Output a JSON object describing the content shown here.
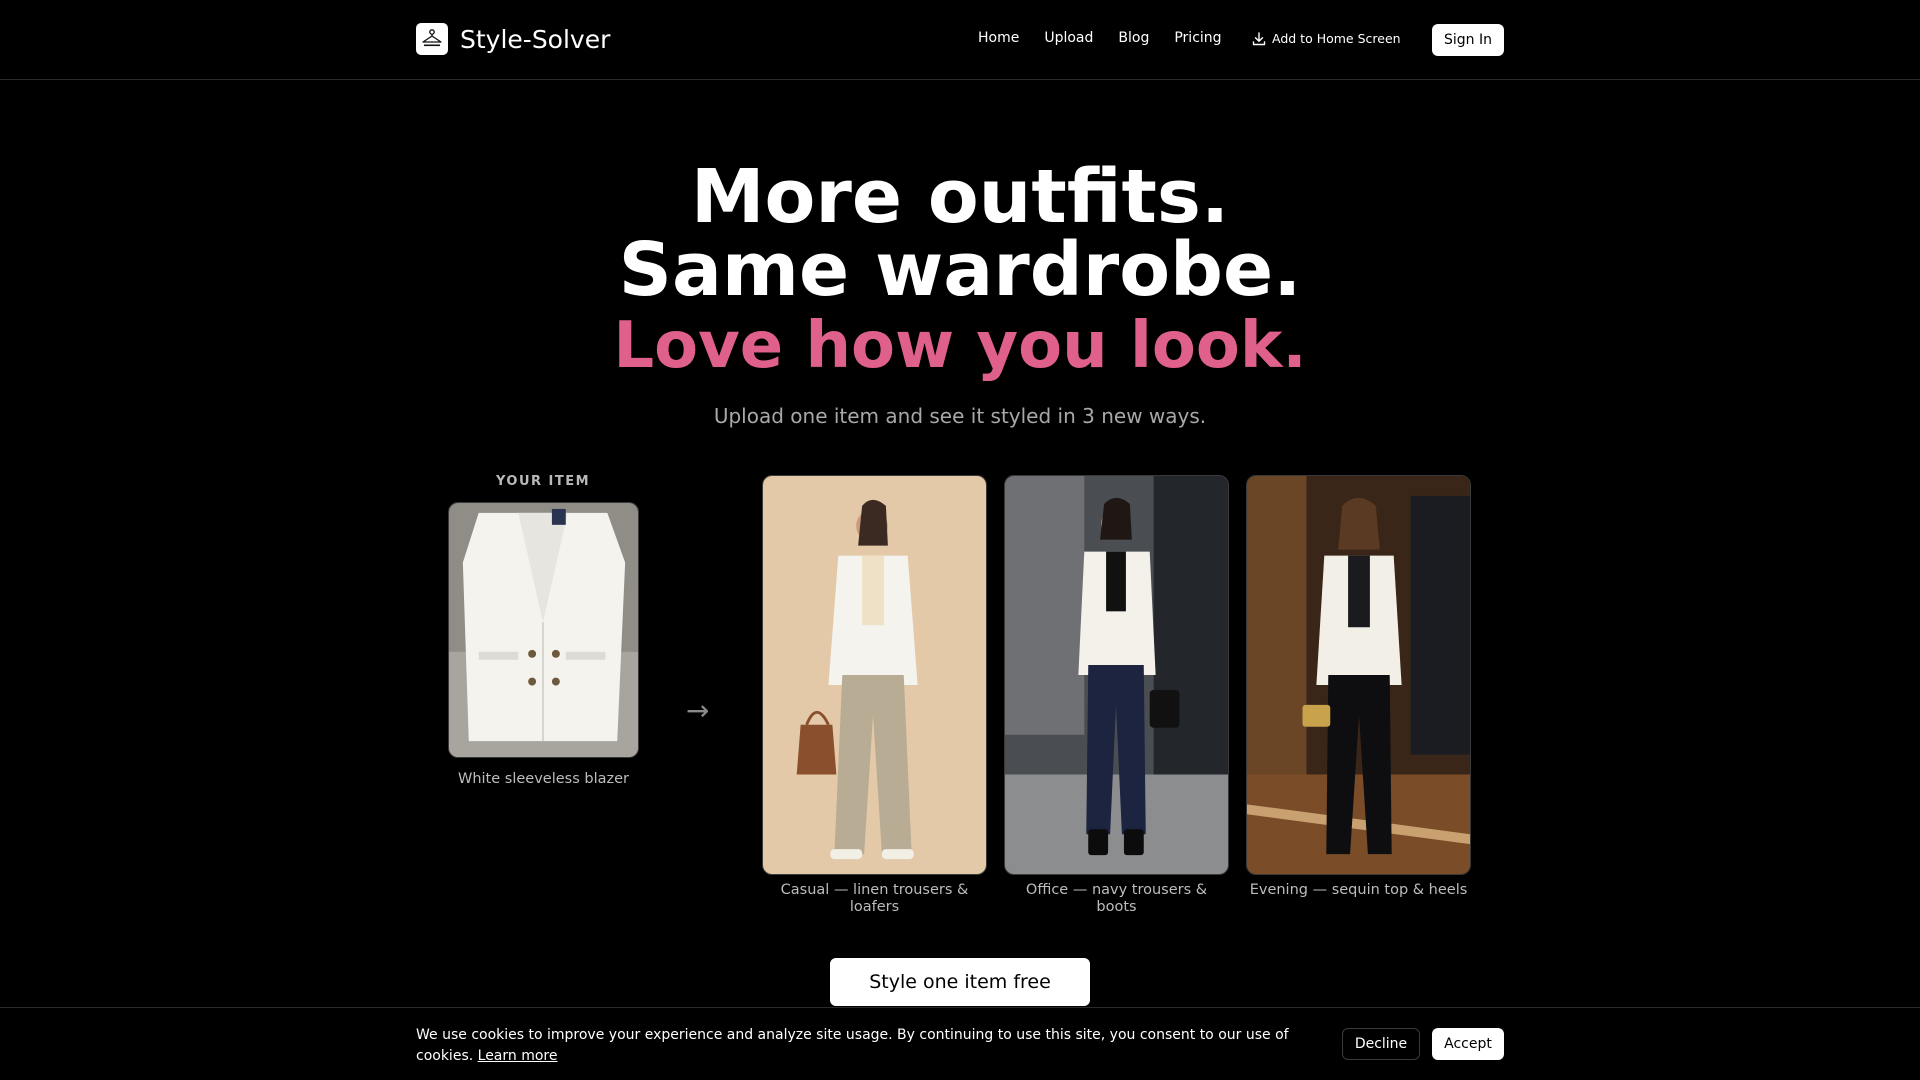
{
  "header": {
    "brand": "Style-Solver",
    "nav": [
      "Home",
      "Upload",
      "Blog",
      "Pricing"
    ],
    "add_to_home": "Add to Home Screen",
    "sign_in": "Sign In",
    "icons": {
      "logo": "hanger-icon",
      "download": "download-icon"
    }
  },
  "hero": {
    "line1": "More outfits.",
    "line2": "Same wardrobe.",
    "line3": "Love how you look.",
    "subtitle": "Upload one item and see it styled in 3 new ways.",
    "accent_color": "#e0608c"
  },
  "showcase": {
    "your_item_label": "YOUR ITEM",
    "item_caption": "White sleeveless blazer",
    "arrow": "→",
    "outfits": [
      {
        "caption": "Casual — linen trousers & loafers"
      },
      {
        "caption": "Office — navy trousers & boots"
      },
      {
        "caption": "Evening — sequin top & heels"
      }
    ]
  },
  "cta": {
    "label": "Style one item free"
  },
  "cookie": {
    "text": "We use cookies to improve your experience and analyze site usage. By continuing to use this site, you consent to our use of cookies.",
    "learn_more": "Learn more",
    "decline": "Decline",
    "accept": "Accept"
  }
}
